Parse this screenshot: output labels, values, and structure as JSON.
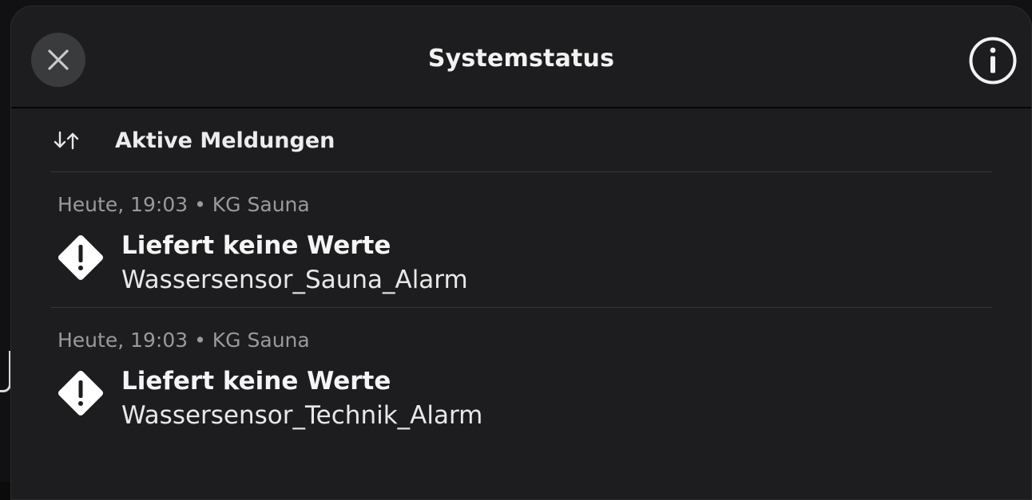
{
  "header": {
    "title": "Systemstatus",
    "close_icon": "close-icon",
    "info_icon": "info-icon"
  },
  "section": {
    "title": "Aktive Meldungen",
    "sort_icon": "sort-arrows-icon"
  },
  "messages": [
    {
      "meta": "Heute, 19:03 • KG Sauna",
      "title": "Liefert keine Werte",
      "device": "Wassersensor_Sauna_Alarm",
      "icon": "warning-diamond-icon"
    },
    {
      "meta": "Heute, 19:03 • KG Sauna",
      "title": "Liefert keine Werte",
      "device": "Wassersensor_Technik_Alarm",
      "icon": "warning-diamond-icon"
    }
  ],
  "colors": {
    "panel": "#1d1d1f",
    "close_button_bg": "#3a3b3d",
    "divider": "#38383b",
    "meta_text": "#9a9a9c",
    "primary_text": "#f5f5f5"
  }
}
